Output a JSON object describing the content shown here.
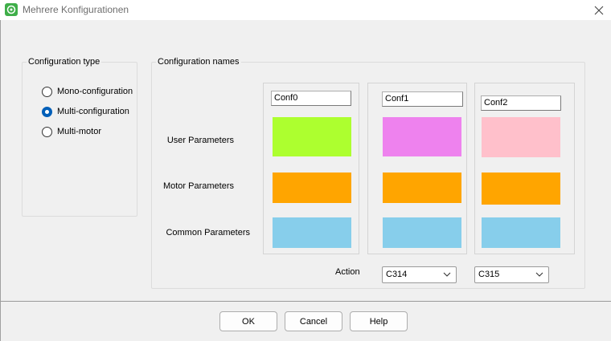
{
  "window": {
    "title": "Mehrere Konfigurationen",
    "app_icon": "app-logo-icon",
    "close_icon": "close-icon"
  },
  "config_type": {
    "legend": "Configuration type",
    "options": [
      {
        "label": "Mono-configuration",
        "checked": false
      },
      {
        "label": "Multi-configuration",
        "checked": true
      },
      {
        "label": "Multi-motor",
        "checked": false
      }
    ]
  },
  "config_names": {
    "legend": "Configuration names",
    "rows": {
      "user": "User Parameters",
      "motor": "Motor Parameters",
      "common": "Common Parameters"
    },
    "configs": [
      {
        "name": "Conf0",
        "colors": {
          "user": "#adff2f",
          "motor": "#ffa500",
          "common": "#87ceeb"
        }
      },
      {
        "name": "Conf1",
        "colors": {
          "user": "#ee82ee",
          "motor": "#ffa500",
          "common": "#87ceeb"
        }
      },
      {
        "name": "Conf2",
        "colors": {
          "user": "#ffc0cb",
          "motor": "#ffa500",
          "common": "#87ceeb"
        }
      }
    ],
    "action_label": "Action",
    "actions": [
      "C314",
      "C315"
    ]
  },
  "buttons": {
    "ok": "OK",
    "cancel": "Cancel",
    "help": "Help"
  },
  "colors": {
    "radio_accent": "#005fb8"
  }
}
